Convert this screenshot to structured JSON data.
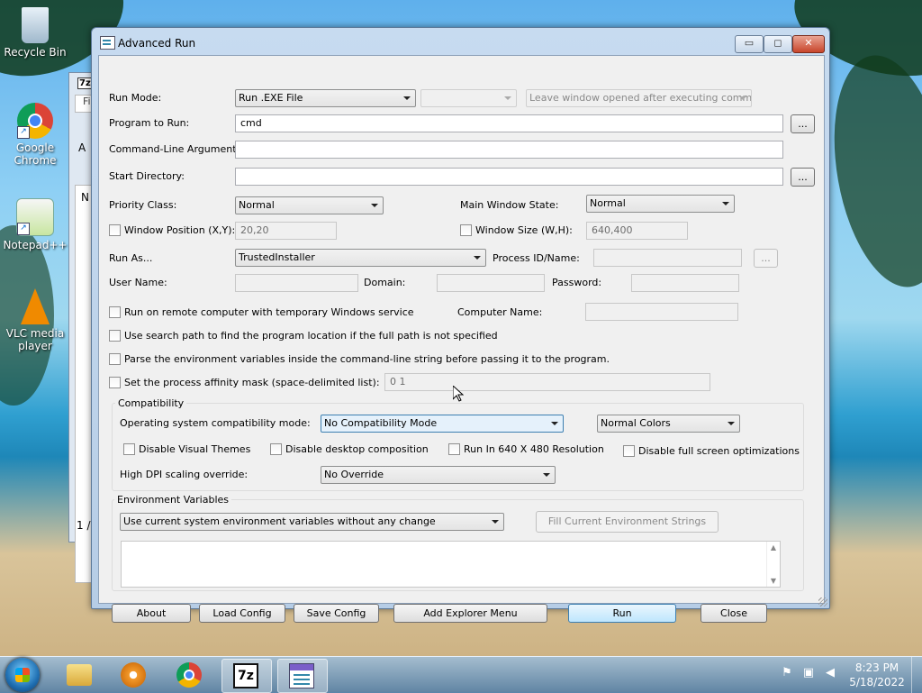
{
  "desktop": {
    "icons": [
      {
        "label": "Recycle Bin"
      },
      {
        "label": "Google Chrome"
      },
      {
        "label": "Notepad++"
      },
      {
        "label": "VLC media player"
      }
    ]
  },
  "window": {
    "title": "Advanced Run",
    "controls": {
      "minimize": "▭",
      "maximize": "◻",
      "close": "✕"
    }
  },
  "form": {
    "run_mode": {
      "label": "Run Mode:",
      "value": "Run .EXE File",
      "aux_value": "",
      "option": "Leave window opened after executing command"
    },
    "program": {
      "label": "Program to Run:",
      "value": "cmd",
      "browse": "..."
    },
    "args": {
      "label": "Command-Line Arguments:",
      "value": ""
    },
    "start_dir": {
      "label": "Start Directory:",
      "value": "",
      "browse": "..."
    },
    "priority": {
      "label": "Priority Class:",
      "value": "Normal"
    },
    "main_window_state": {
      "label": "Main Window State:",
      "value": "Normal"
    },
    "window_position": {
      "label": "Window Position (X,Y):",
      "value": "20,20"
    },
    "window_size": {
      "label": "Window Size (W,H):",
      "value": "640,400"
    },
    "run_as": {
      "label": "Run As...",
      "value": "TrustedInstaller"
    },
    "process_id": {
      "label": "Process ID/Name:",
      "value": "",
      "browse": "..."
    },
    "user_name": {
      "label": "User Name:",
      "value": ""
    },
    "domain": {
      "label": "Domain:",
      "value": ""
    },
    "password": {
      "label": "Password:",
      "value": ""
    },
    "remote": {
      "label": "Run on remote computer with temporary Windows service"
    },
    "computer_name": {
      "label": "Computer Name:",
      "value": ""
    },
    "search_path": {
      "label": "Use search path to find the program location if the full path is not specified"
    },
    "parse_env": {
      "label": "Parse the environment variables inside the command-line string before passing it to the program."
    },
    "affinity": {
      "label": "Set the process affinity mask (space-delimited list):",
      "value": "0 1"
    }
  },
  "compat": {
    "group_label": "Compatibility",
    "os_mode": {
      "label": "Operating system compatibility mode:",
      "value": "No Compatibility Mode"
    },
    "colors": {
      "value": "Normal Colors"
    },
    "disable_themes": "Disable Visual Themes",
    "disable_composition": "Disable desktop composition",
    "run_640": "Run In 640 X 480 Resolution",
    "disable_fullscreen": "Disable full screen optimizations",
    "dpi": {
      "label": "High DPI scaling override:",
      "value": "No Override"
    }
  },
  "env": {
    "group_label": "Environment Variables",
    "mode": "Use current system environment variables without any change",
    "fill_button": "Fill Current Environment Strings",
    "text": ""
  },
  "buttons": {
    "about": "About",
    "load": "Load Config",
    "save": "Save Config",
    "explorer": "Add Explorer Menu",
    "run": "Run",
    "close": "Close"
  },
  "bg_window": {
    "title": "7z",
    "frag1": "Fi",
    "frag2": "A",
    "frag3": "N",
    "status": "1 /"
  },
  "taskbar": {
    "time": "8:23 PM",
    "date": "5/18/2022",
    "apps": [
      "Windows Explorer",
      "Windows Media Player",
      "Google Chrome",
      "7-Zip",
      "Advanced Run"
    ]
  }
}
